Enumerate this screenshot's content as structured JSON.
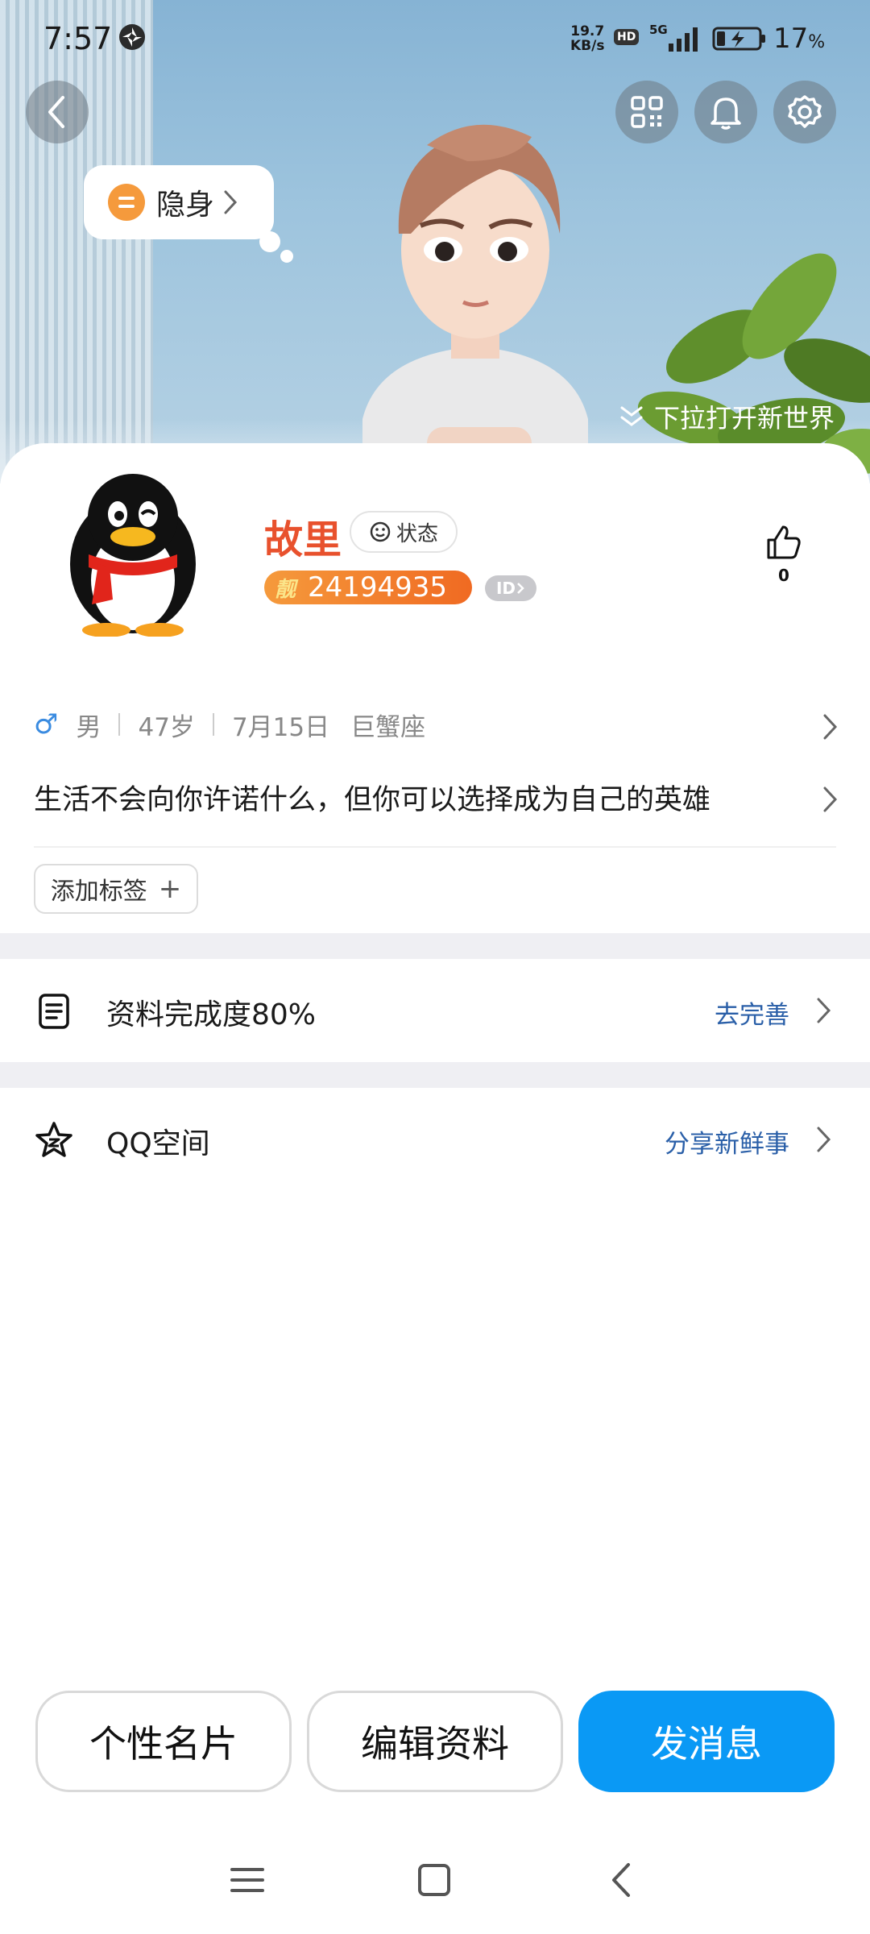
{
  "status_bar": {
    "time": "7:57",
    "speed_value": "19.7",
    "speed_unit": "KB/s",
    "hd": "HD",
    "network": "5G",
    "battery": "17",
    "battery_unit": "%"
  },
  "hero": {
    "stealth_label": "隐身",
    "pull_hint": "下拉打开新世界"
  },
  "profile": {
    "nickname": "故里",
    "status_label": "状态",
    "liang_label": "靓",
    "qq_number": "24194935",
    "id_badge": "ID",
    "likes": "0",
    "gender": "男",
    "age": "47岁",
    "birthday": "7月15日",
    "zodiac": "巨蟹座",
    "signature": "生活不会向你许诺什么，但你可以选择成为自己的英雄",
    "add_tag": "添加标签"
  },
  "rows": {
    "profile_completion": "资料完成度80%",
    "profile_action": "去完善",
    "qzone": "QQ空间",
    "qzone_action": "分享新鲜事"
  },
  "buttons": {
    "card": "个性名片",
    "edit": "编辑资料",
    "message": "发消息"
  },
  "colors": {
    "accent_blue": "#0a99f5",
    "nickname_red": "#e8512d",
    "link_blue": "#2a5fa8",
    "id_orange": "#f06a22"
  }
}
